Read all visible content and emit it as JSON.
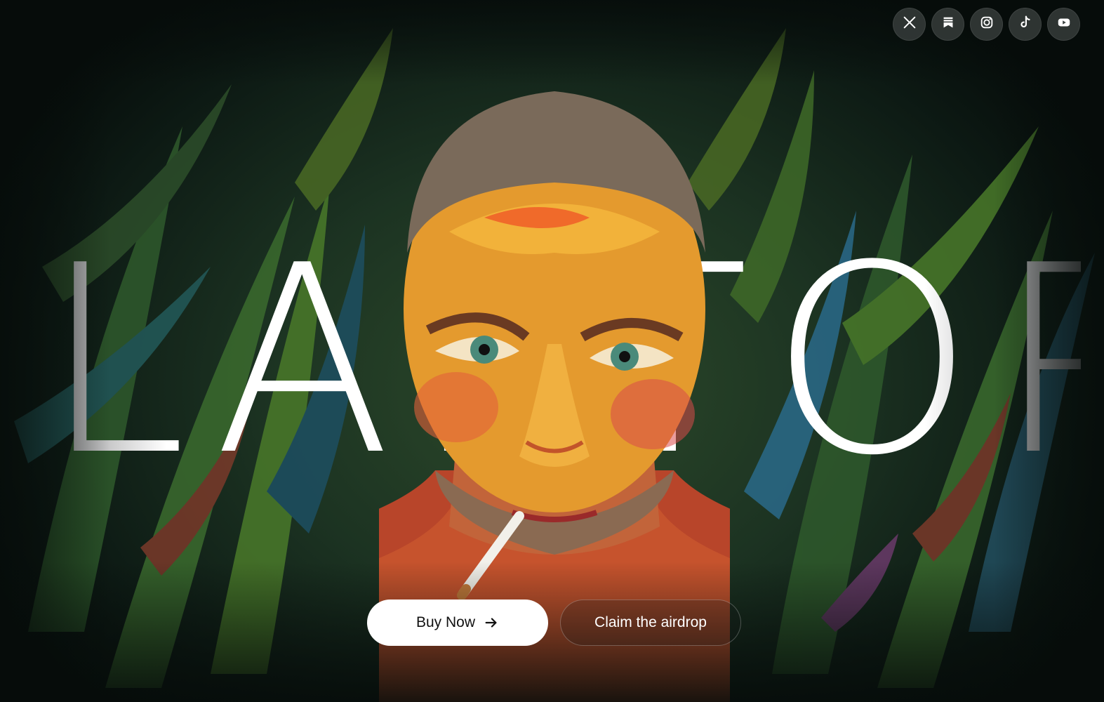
{
  "hero": {
    "title": "LAPTOP",
    "background_colors": {
      "deep": "#0d1a14",
      "mid": "#1c3322",
      "accent_leaf": "#3f7a3a",
      "accent_blue": "#2a6a8a",
      "skin": "#e8a030"
    }
  },
  "social": {
    "items": [
      {
        "icon": "x-icon",
        "label": "X"
      },
      {
        "icon": "substack-icon",
        "label": "Substack"
      },
      {
        "icon": "instagram-icon",
        "label": "Instagram"
      },
      {
        "icon": "tiktok-icon",
        "label": "TikTok"
      },
      {
        "icon": "youtube-icon",
        "label": "YouTube"
      }
    ]
  },
  "cta": {
    "buy_label": "Buy Now",
    "buy_icon": "arrow-right-icon",
    "airdrop_label": "Claim the airdrop"
  }
}
